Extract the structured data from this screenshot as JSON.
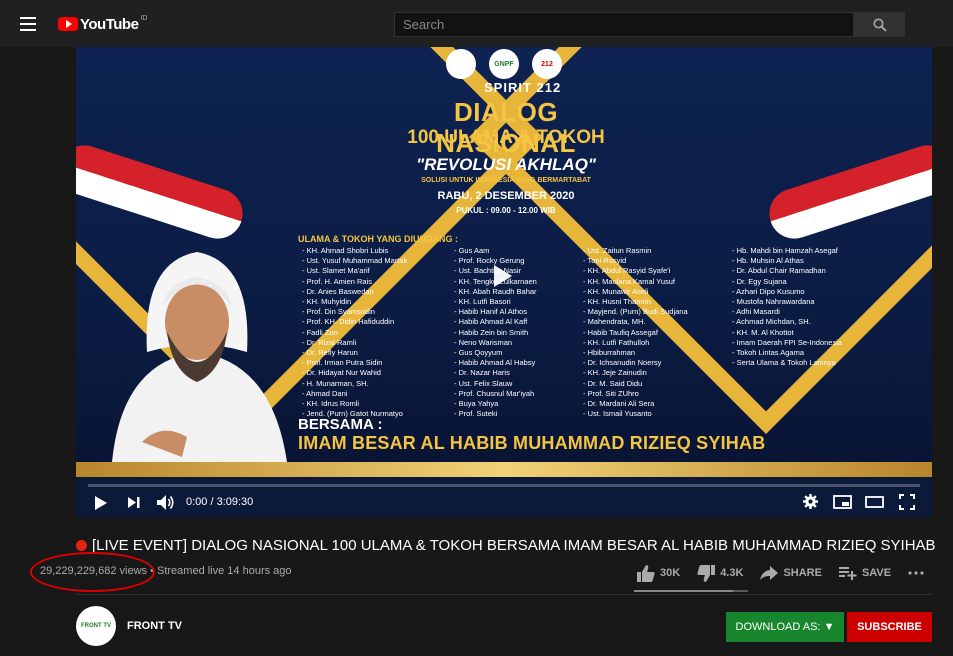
{
  "header": {
    "logo_text": "YouTube",
    "logo_region": "ID",
    "search_placeholder": "Search"
  },
  "video": {
    "spirit": "SPIRIT 212",
    "title_line1": "DIALOG NASIONAL",
    "title_line2": "100 ULAMA & TOKOH",
    "revolusi": "\"REVOLUSI AKHLAQ\"",
    "subtitle": "SOLUSI UNTUK INDONESIA YANG BERMARTABAT",
    "date": "RABU, 2 DESEMBER 2020",
    "time": "PUKUL : 09.00 - 12.00 WIB",
    "badge_center": "GNPF",
    "badge_right": "212",
    "invited_heading": "ULAMA & TOKOH YANG DIUNDANG :",
    "column1": [
      "- KH. Ahmad Shobri Lubis",
      "- Ust. Yusuf Muhammad Martak",
      "- Ust. Slamet Ma'arif",
      "- Prof. H. Amien Rais",
      "- Dr. Anies Baswedan",
      "- KH. Muhyidin",
      "- Prof. Din Syamsudin",
      "- Prof. KH. Didin Hafiduddin",
      "- Fadli Zon",
      "- Dr. Rizal Ramli",
      "- Dr. Refly Harun",
      "- Prof. Irman Putra Sidin",
      "- Dr. Hidayat Nur Wahid",
      "- H. Munarman, SH.",
      "- Ahmad Dani",
      "- KH. Idrus Romli",
      "- Jend. (Purn) Gatot Nurmatyo"
    ],
    "column2": [
      "- Gus Aam",
      "- Prof. Rocky Gerung",
      "- Ust. Bachtiar Nasir",
      "- KH. Tengku Zulkarnaen",
      "- KH. Abah Raudh Bahar",
      "- KH. Lutfi Basori",
      "- Habib Hanif Al Athos",
      "- Habib Ahmad Al Kaff",
      "- Habib Zein bin Smith",
      "- Neno Warisman",
      "- Gus Qoyyum",
      "- Habib Ahmad Al Habsy",
      "- Dr. Nazar Haris",
      "- Ust. Felix Slauw",
      "- Prof. Chusnul Mar'iyah",
      "- Buya Yahya",
      "- Prof. Suteki"
    ],
    "column3": [
      "- Ust. Zaitun Rasmin",
      "- Toni Rosyid",
      "- KH. Abdul Rasyid Syafe'i",
      "- KH. Maulana Kamal Yusuf",
      "- KH. Munawir Aseli",
      "- KH. Husni Thamrin",
      "- Mayjend. (Purn) Budi Sudjana",
      "- Mahendrata, MH.",
      "- Habib Taufiq Assegaf",
      "- KH. Lutfi Fathulloh",
      "- Hbiburrahman",
      "- Dr. Ichsanudin Noersy",
      "- KH. Jeje Zainudin",
      "- Dr. M. Said Didu",
      "- Prof. Siti ZUhro",
      "- Dr. Mardani Ali Sera",
      "- Ust. Ismail Yusanto"
    ],
    "column4": [
      "- Hb. Mahdi bin Hamzah Asegaf",
      "- Hb. Muhsin Al Athas",
      "- Dr. Abdul Chair Ramadhan",
      "- Dr. Egy Sujana",
      "- Azhari Dipo Kusumo",
      "- Mustofa Nahrawardana",
      "- Adhi Masardi",
      "- Achmad Michdan, SH.",
      "- KH. M. Al Khottot",
      "- Imam Daerah FPI Se-Indonesia",
      "- Tokoh Lintas Agama",
      "- Serta Ulama & Tokoh Lainnya"
    ],
    "bersama": "BERSAMA :",
    "imam": "IMAM BESAR AL HABIB MUHAMMAD RIZIEQ SYIHAB",
    "timecode": "0:00 / 3:09:30"
  },
  "info": {
    "title": "[LIVE EVENT] DIALOG NASIONAL 100 ULAMA & TOKOH BERSAMA IMAM BESAR AL HABIB MUHAMMAD RIZIEQ SYIHAB",
    "views": "29,229,229,682 views",
    "streamed": " • Streamed live 14 hours ago",
    "likes": "30K",
    "dislikes": "4.3K",
    "share": "SHARE",
    "save": "SAVE",
    "like_ratio": 0.87
  },
  "channel": {
    "name": "FRONT TV",
    "avatar_text": "FRONT TV",
    "download_label": "DOWNLOAD AS:",
    "download_arrow": "▼",
    "subscribe_label": "SUBSCRIBE"
  },
  "colors": {
    "accent_red": "#cc0000",
    "download_green": "#18862c",
    "banner_gold": "#f4c542"
  }
}
